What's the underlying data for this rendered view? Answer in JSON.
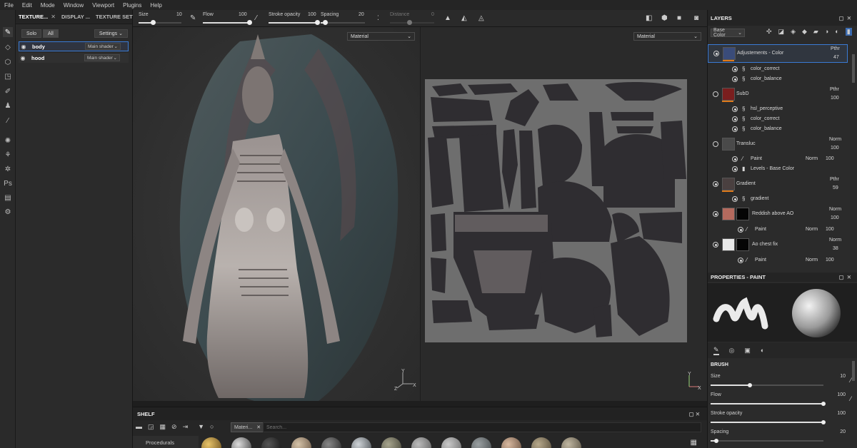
{
  "menu": [
    "File",
    "Edit",
    "Mode",
    "Window",
    "Viewport",
    "Plugins",
    "Help"
  ],
  "texture_panel": {
    "tabs": [
      "TEXTURE...",
      "DISPLAY ...",
      "TEXTURE SET ..."
    ],
    "solo_label": "Solo",
    "all_label": "All",
    "settings_label": "Settings",
    "sets": [
      {
        "name": "body",
        "shader": "Main shader",
        "selected": true
      },
      {
        "name": "hood",
        "shader": "Main shader",
        "selected": false
      }
    ]
  },
  "toolbar": {
    "size_label": "Size",
    "size_value": "10",
    "flow_label": "Flow",
    "flow_value": "100",
    "stroke_label": "Stroke opacity",
    "stroke_value": "100",
    "spacing_label": "Spacing",
    "spacing_value": "20",
    "distance_label": "Distance",
    "distance_value": "0"
  },
  "viewport3d": {
    "material_select": "Material"
  },
  "viewport2d": {
    "material_select": "Material"
  },
  "shelf": {
    "title": "SHELF",
    "filter_tab": "Materi...",
    "search_placeholder": "Search...",
    "category": "Procedurals"
  },
  "layers": {
    "title": "LAYERS",
    "channel": "Base Color",
    "items": [
      {
        "name": "Adjustements - Color",
        "blend": "Pthr",
        "opacity": "47"
      },
      {
        "name": "color_correct"
      },
      {
        "name": "color_balance"
      },
      {
        "name": "SubD",
        "blend": "Pthr",
        "opacity": "100"
      },
      {
        "name": "hsl_perceptive"
      },
      {
        "name": "color_correct"
      },
      {
        "name": "color_balance"
      },
      {
        "name": "Transluc",
        "blend": "Norm",
        "opacity": "100"
      },
      {
        "name": "Paint",
        "blend": "Norm",
        "opacity": "100"
      },
      {
        "name": "Levels - Base Color"
      },
      {
        "name": "Gradient",
        "blend": "Pthr",
        "opacity": "59"
      },
      {
        "name": "gradient"
      },
      {
        "name": "Reddish above AO",
        "blend": "Norm",
        "opacity": "100"
      },
      {
        "name": "Paint",
        "blend": "Norm",
        "opacity": "100"
      },
      {
        "name": "Ao chest fix",
        "blend": "Norm",
        "opacity": "38"
      },
      {
        "name": "Paint",
        "blend": "Norm",
        "opacity": "100"
      }
    ]
  },
  "properties": {
    "title": "PROPERTIES - PAINT",
    "section": "BRUSH",
    "size_label": "Size",
    "size_value": "10",
    "size_fraction": 0.35,
    "flow_label": "Flow",
    "flow_value": "100",
    "flow_fraction": 1.0,
    "stroke_label": "Stroke opacity",
    "stroke_value": "100",
    "stroke_fraction": 1.0,
    "spacing_label": "Spacing",
    "spacing_value": "20",
    "spacing_fraction": 0.05
  },
  "colors": {
    "accent": "#3a7bd5",
    "panel": "#2b2b2b",
    "viewport": "#303030"
  }
}
